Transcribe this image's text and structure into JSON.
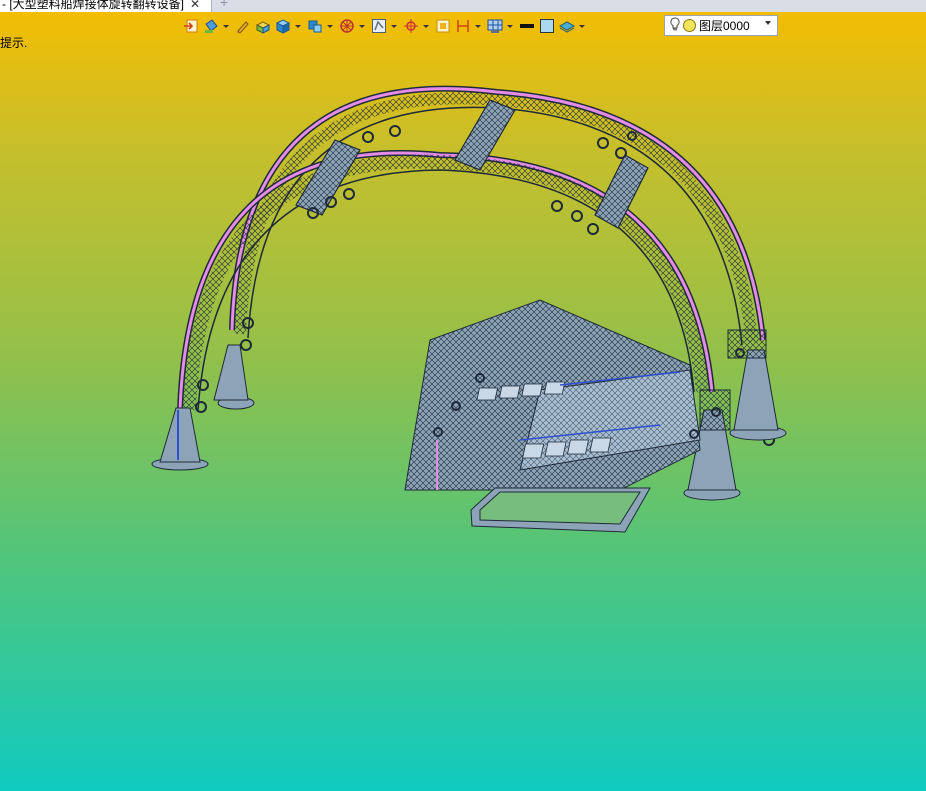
{
  "tab": {
    "title": "- [大型塑料船焊接体旋转翻转设备]",
    "close": "✕",
    "new": "+"
  },
  "hint": {
    "text": "提示."
  },
  "toolbar": {
    "icons": [
      "exit-icon",
      "paint-bucket-icon",
      "pen-icon",
      "solid-block-icon",
      "cube-icon",
      "cube-view-icon",
      "wheel-icon",
      "frame-icon",
      "target-icon",
      "square-icon",
      "dimension-icon",
      "grid-view-icon",
      "line-style-icon",
      "fill-color-icon",
      "layer-stack-icon"
    ]
  },
  "layer": {
    "name": "图层0000"
  },
  "colors": {
    "arch_rail": "#e48ce6",
    "steel": "#8da4b8",
    "wire": "#1e2a38",
    "blue_accent": "#2e4fd0"
  }
}
